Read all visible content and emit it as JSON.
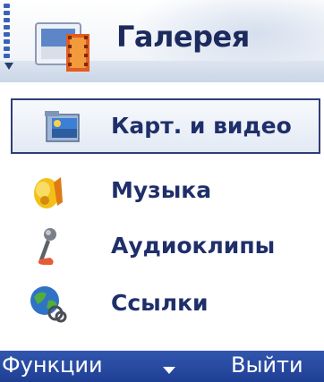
{
  "header": {
    "title": "Галерея",
    "icon": "gallery-film-icon"
  },
  "menu": {
    "items": [
      {
        "label": "Карт. и видео",
        "icon": "images-video-folder-icon",
        "selected": true
      },
      {
        "label": "Музыка",
        "icon": "music-folder-icon",
        "selected": false
      },
      {
        "label": "Аудиоклипы",
        "icon": "microphone-icon",
        "selected": false
      },
      {
        "label": "Ссылки",
        "icon": "globe-link-icon",
        "selected": false
      }
    ]
  },
  "softkeys": {
    "left": "Функции",
    "right": "Выйти"
  },
  "colors": {
    "title_text": "#1c2a5e",
    "softkey_bar": "#2a4aa3",
    "selection_border": "#2e3e78"
  }
}
